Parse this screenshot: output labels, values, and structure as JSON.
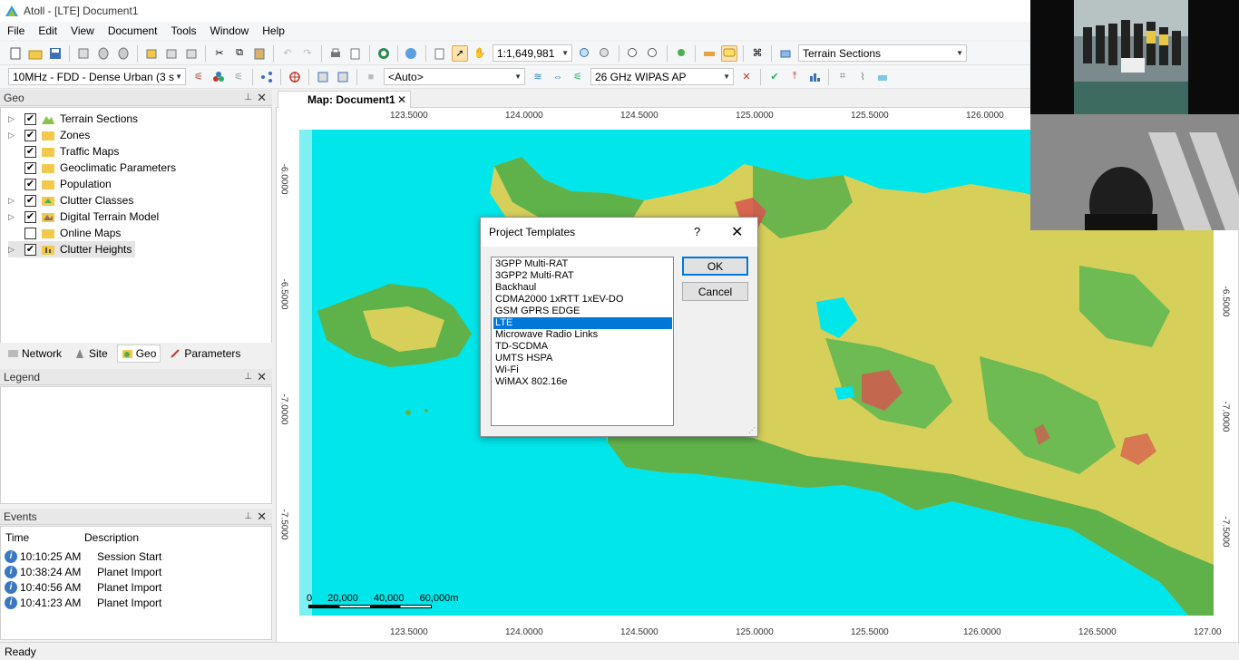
{
  "window": {
    "title": "Atoll - [LTE] Document1"
  },
  "menu": [
    "File",
    "Edit",
    "View",
    "Document",
    "Tools",
    "Window",
    "Help"
  ],
  "toolbar1": {
    "scale_value": "1:1,649,981",
    "layer_combo": "Terrain Sections"
  },
  "toolbar2": {
    "network_combo": "10MHz - FDD - Dense Urban (3 sec",
    "auto_combo": "<Auto>",
    "radio_combo": "26 GHz WIPAS AP"
  },
  "geo_panel": {
    "title": "Geo",
    "items": [
      {
        "label": "Terrain Sections",
        "checked": true,
        "expandable": true
      },
      {
        "label": "Zones",
        "checked": true,
        "expandable": true
      },
      {
        "label": "Traffic Maps",
        "checked": true,
        "expandable": false
      },
      {
        "label": "Geoclimatic Parameters",
        "checked": true,
        "expandable": false
      },
      {
        "label": "Population",
        "checked": true,
        "expandable": false
      },
      {
        "label": "Clutter Classes",
        "checked": true,
        "expandable": true
      },
      {
        "label": "Digital Terrain Model",
        "checked": true,
        "expandable": true
      },
      {
        "label": "Online Maps",
        "checked": false,
        "expandable": false
      },
      {
        "label": "Clutter Heights",
        "checked": true,
        "expandable": true
      }
    ],
    "tabs": [
      "Network",
      "Site",
      "Geo",
      "Parameters"
    ],
    "active_tab": "Geo"
  },
  "legend_panel": {
    "title": "Legend"
  },
  "events_panel": {
    "title": "Events",
    "columns": [
      "Time",
      "Description"
    ],
    "rows": [
      {
        "time": "10:10:25 AM",
        "description": "Session Start"
      },
      {
        "time": "10:38:24 AM",
        "description": "Planet Import"
      },
      {
        "time": "10:40:56 AM",
        "description": "Planet Import"
      },
      {
        "time": "10:41:23 AM",
        "description": "Planet Import"
      }
    ]
  },
  "map": {
    "tab_label": "Map: Document1",
    "top_ruler": [
      "123.5000",
      "124.0000",
      "124.5000",
      "125.0000",
      "125.5000",
      "126.0000"
    ],
    "bottom_ruler": [
      "123.5000",
      "124.0000",
      "124.5000",
      "125.0000",
      "125.5000",
      "126.0000",
      "126.5000",
      "127.00"
    ],
    "left_ruler": [
      "-6.0000",
      "-6.5000",
      "-7.0000",
      "-7.5000"
    ],
    "right_ruler": [
      "-6.5000",
      "-7.0000",
      "-7.5000"
    ],
    "scale_text": "0 20,000 40,000 60,000m",
    "colors": {
      "sea": "#00e6ea",
      "land_yellow": "#d6cf5a",
      "land_green": "#5fb14a",
      "urban_red": "#d9534f"
    }
  },
  "dialog": {
    "title": "Project Templates",
    "help": "?",
    "templates": [
      "3GPP Multi-RAT",
      "3GPP2 Multi-RAT",
      "Backhaul",
      "CDMA2000 1xRTT 1xEV-DO",
      "GSM GPRS EDGE",
      "LTE",
      "Microwave Radio Links",
      "TD-SCDMA",
      "UMTS HSPA",
      "Wi-Fi",
      "WiMAX 802.16e"
    ],
    "selected": "LTE",
    "ok_label": "OK",
    "cancel_label": "Cancel"
  },
  "status": {
    "text": "Ready"
  }
}
